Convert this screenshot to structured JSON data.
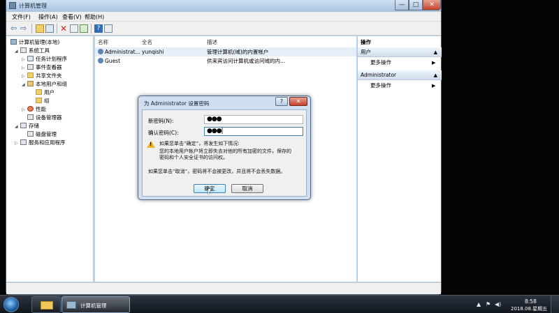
{
  "window": {
    "title": "计算机管理",
    "min": "—",
    "max": "□",
    "close": "✕"
  },
  "menu": [
    "文件(F)",
    "操作(A)",
    "查看(V)",
    "帮助(H)"
  ],
  "tree": [
    {
      "label": "计算机管理(本地)",
      "expander": "",
      "icon": "computer-icon"
    },
    {
      "label": "系统工具",
      "expander": "◢",
      "icon": "tools-icon"
    },
    {
      "label": "任务计划程序",
      "expander": "▷",
      "icon": "clock-icon"
    },
    {
      "label": "事件查看器",
      "expander": "▷",
      "icon": "event-viewer-icon"
    },
    {
      "label": "共享文件夹",
      "expander": "▷",
      "icon": "shared-folder-icon"
    },
    {
      "label": "本地用户和组",
      "expander": "◢",
      "icon": "users-icon"
    },
    {
      "label": "用户",
      "expander": "",
      "icon": "folder-icon"
    },
    {
      "label": "组",
      "expander": "",
      "icon": "folder-icon"
    },
    {
      "label": "性能",
      "expander": "▷",
      "icon": "performance-icon"
    },
    {
      "label": "设备管理器",
      "expander": "",
      "icon": "device-manager-icon"
    },
    {
      "label": "存储",
      "expander": "◢",
      "icon": "storage-icon"
    },
    {
      "label": "磁盘管理",
      "expander": "",
      "icon": "disk-icon"
    },
    {
      "label": "服务和应用程序",
      "expander": "▷",
      "icon": "services-icon"
    }
  ],
  "list": {
    "columns": [
      "名称",
      "全名",
      "描述"
    ],
    "rows": [
      {
        "name": "Administrat...",
        "full": "yunqishi",
        "desc": "管理计算机(域)的内置帐户"
      },
      {
        "name": "Guest",
        "full": "",
        "desc": "供来宾访问计算机或访问域的内..."
      }
    ]
  },
  "actions": {
    "header": "操作",
    "sections": [
      {
        "title": "用户",
        "item": "更多操作"
      },
      {
        "title": "Administrator",
        "item": "更多操作"
      }
    ]
  },
  "dialog": {
    "title": "为 Administrator 设置密码",
    "help": "?",
    "close": "✕",
    "new_pw_label": "新密码(N):",
    "new_pw_value": "●●●",
    "confirm_pw_label": "确认密码(C):",
    "confirm_pw_value": "●●●|",
    "warn_line1": "如果您单击“确定”，将发生如下情况:",
    "warn_line2": "您的本地用户帐户将立即失去对他的所有加密的文件，保存的",
    "warn_line3": "密码和个人安全证书的访问权。",
    "cancel_note": "如果您单击“取消”，密码将不会被更改，并且将不会丢失数据。",
    "ok": "确定",
    "cancel": "取消"
  },
  "taskbar": {
    "active_app": "计算机管理",
    "time": "8:58",
    "date": "2018.08.星期五"
  }
}
